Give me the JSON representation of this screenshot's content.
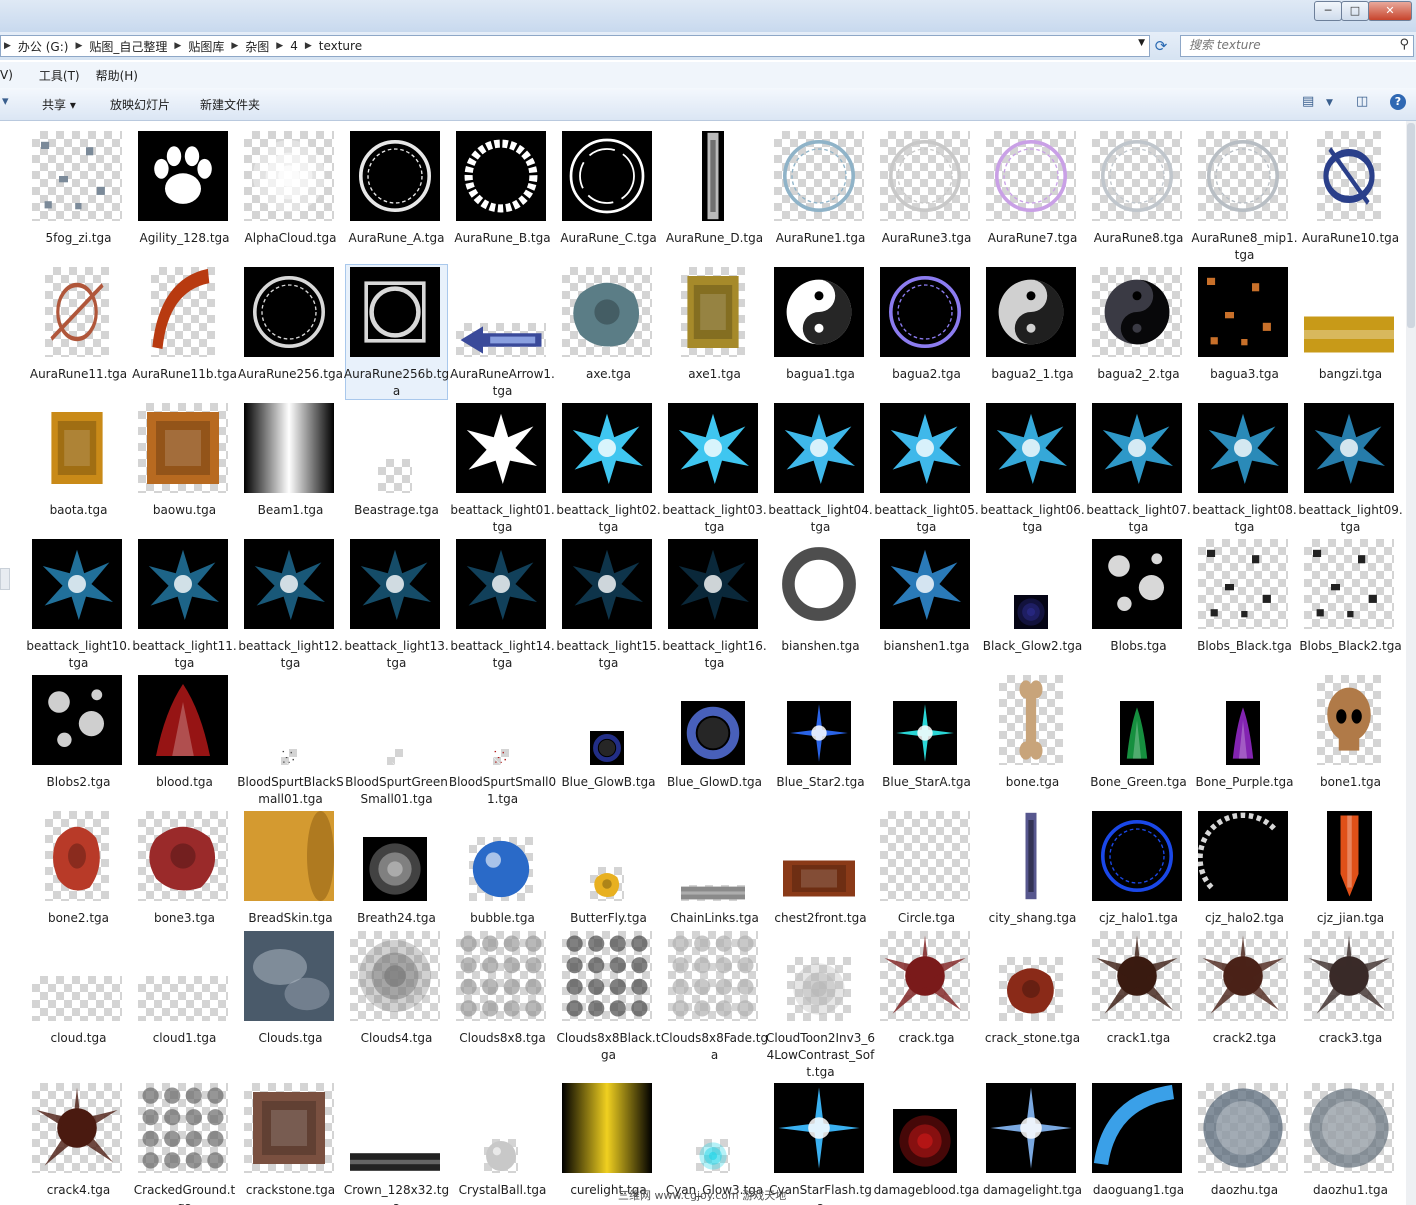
{
  "window": {
    "min_icon": "─",
    "max_icon": "□",
    "close_icon": "✕"
  },
  "address": {
    "crumbs": [
      "办公 (G:)",
      "贴图_自己整理",
      "贴图库",
      "杂图",
      "4",
      "texture"
    ],
    "search_placeholder": "搜索 texture"
  },
  "menu": [
    "V)",
    "工具(T)",
    "帮助(H)"
  ],
  "commands": {
    "share": "共享 ▾",
    "slideshow": "放映幻灯片",
    "new_folder": "新建文件夹"
  },
  "watermark": "三维网 www.cgjoy.com 游戏天地",
  "files": [
    {
      "name": "5fog_zi.tga",
      "bg": "checker",
      "art": "specks",
      "c": "#7b8a99"
    },
    {
      "name": "Agility_128.tga",
      "bg": "black",
      "art": "paw",
      "c": "#ffffff"
    },
    {
      "name": "AlphaCloud.tga",
      "bg": "checker",
      "art": "glow",
      "c": "#ffffff"
    },
    {
      "name": "AuraRune_A.tga",
      "bg": "black",
      "art": "ring",
      "c": "#e8e8e8"
    },
    {
      "name": "AuraRune_B.tga",
      "bg": "black",
      "art": "thickring",
      "c": "#ffffff"
    },
    {
      "name": "AuraRune_C.tga",
      "bg": "black",
      "art": "ring2",
      "c": "#ffffff"
    },
    {
      "name": "AuraRune_D.tga",
      "bg": "black",
      "art": "strip",
      "c": "#dcdcdc",
      "w": 22
    },
    {
      "name": "AuraRune1.tga",
      "bg": "checker",
      "art": "ring",
      "c": "#8fb3c8"
    },
    {
      "name": "AuraRune3.tga",
      "bg": "checker",
      "art": "ring",
      "c": "#c8c8c8"
    },
    {
      "name": "AuraRune7.tga",
      "bg": "checker",
      "art": "ring",
      "c": "#c9a0e6"
    },
    {
      "name": "AuraRune8.tga",
      "bg": "checker",
      "art": "ring",
      "c": "#c0c6cc"
    },
    {
      "name": "AuraRune8_mip1.tga",
      "bg": "checker",
      "art": "ring",
      "c": "#b8bec4"
    },
    {
      "name": "AuraRune10.tga",
      "bg": "checker",
      "art": "emblem",
      "c": "#2a3f8a",
      "w": 64
    },
    {
      "name": "AuraRune11.tga",
      "bg": "checker",
      "art": "rune",
      "c": "#b0563a",
      "w": 64
    },
    {
      "name": "AuraRune11b.tga",
      "bg": "checker",
      "art": "arc",
      "c": "#b83a10",
      "w": 64
    },
    {
      "name": "AuraRune256.tga",
      "bg": "black",
      "art": "ring",
      "c": "#d8d8d8"
    },
    {
      "name": "AuraRune256b.tga",
      "bg": "black",
      "art": "square",
      "c": "#d8d8d8"
    },
    {
      "name": "AuraRuneArrow1.tga",
      "bg": "checker",
      "art": "arrow",
      "c": "#3a4a9a",
      "w": 90,
      "h": 34
    },
    {
      "name": "axe.tga",
      "bg": "checker",
      "art": "blob",
      "c": "#5b7d86"
    },
    {
      "name": "axe1.tga",
      "bg": "checker",
      "art": "block",
      "c": "#a68a2a",
      "w": 64
    },
    {
      "name": "bagua1.tga",
      "bg": "black",
      "art": "yinyang",
      "c": "#ffffff"
    },
    {
      "name": "bagua2.tga",
      "bg": "black",
      "art": "ring",
      "c": "#8c7cf0"
    },
    {
      "name": "bagua2_1.tga",
      "bg": "black",
      "art": "yinyang",
      "c": "#d0d0d0"
    },
    {
      "name": "bagua2_2.tga",
      "bg": "checker",
      "art": "yinyang",
      "c": "#3a3a44"
    },
    {
      "name": "bagua3.tga",
      "bg": "black",
      "art": "specks",
      "c": "#c8702a"
    },
    {
      "name": "bangzi.tga",
      "bg": "none",
      "art": "bar",
      "c": "#c89a18",
      "h": 45
    },
    {
      "name": "baota.tga",
      "bg": "none",
      "art": "block",
      "c": "#c98a18",
      "w": 64
    },
    {
      "name": "baowu.tga",
      "bg": "checker",
      "art": "block",
      "c": "#b86a20"
    },
    {
      "name": "Beam1.tga",
      "bg": "black",
      "art": "beam",
      "c": "#ffffff"
    },
    {
      "name": "Beastrage.tga",
      "bg": "checker",
      "art": "none",
      "c": "#cccccc",
      "w": 34,
      "h": 34
    },
    {
      "name": "beattack_light01.tga",
      "bg": "black",
      "art": "splash",
      "c": "#ffffff"
    },
    {
      "name": "beattack_light02.tga",
      "bg": "black",
      "art": "splash",
      "c": "#3fc6f0"
    },
    {
      "name": "beattack_light03.tga",
      "bg": "black",
      "art": "splash",
      "c": "#3fc6f0"
    },
    {
      "name": "beattack_light04.tga",
      "bg": "black",
      "art": "splash",
      "c": "#3fb8ea"
    },
    {
      "name": "beattack_light05.tga",
      "bg": "black",
      "art": "splash",
      "c": "#3fb8ea"
    },
    {
      "name": "beattack_light06.tga",
      "bg": "black",
      "art": "splash",
      "c": "#35a8d8"
    },
    {
      "name": "beattack_light07.tga",
      "bg": "black",
      "art": "splash",
      "c": "#2e98c8"
    },
    {
      "name": "beattack_light08.tga",
      "bg": "black",
      "art": "splash",
      "c": "#2a8ab8"
    },
    {
      "name": "beattack_light09.tga",
      "bg": "black",
      "art": "splash",
      "c": "#267caa"
    },
    {
      "name": "beattack_light10.tga",
      "bg": "black",
      "art": "splash",
      "c": "#21709a"
    },
    {
      "name": "beattack_light11.tga",
      "bg": "black",
      "art": "splash",
      "c": "#1d6488"
    },
    {
      "name": "beattack_light12.tga",
      "bg": "black",
      "art": "splash",
      "c": "#195878"
    },
    {
      "name": "beattack_light13.tga",
      "bg": "black",
      "art": "splash",
      "c": "#154c68"
    },
    {
      "name": "beattack_light14.tga",
      "bg": "black",
      "art": "splash",
      "c": "#11405a"
    },
    {
      "name": "beattack_light15.tga",
      "bg": "black",
      "art": "splash",
      "c": "#0e344a"
    },
    {
      "name": "beattack_light16.tga",
      "bg": "black",
      "art": "splash",
      "c": "#0a283a"
    },
    {
      "name": "bianshen.tga",
      "bg": "none",
      "art": "softring",
      "c": "#222222"
    },
    {
      "name": "bianshen1.tga",
      "bg": "black",
      "art": "splash",
      "c": "#2a7ab8"
    },
    {
      "name": "Black_Glow2.tga",
      "bg": "none",
      "art": "glow",
      "c": "#2a2a8a",
      "w": 34,
      "h": 34,
      "fill": "#050515"
    },
    {
      "name": "Blobs.tga",
      "bg": "black",
      "art": "blobs",
      "c": "#d8d8d8"
    },
    {
      "name": "Blobs_Black.tga",
      "bg": "checker",
      "art": "specks",
      "c": "#222222"
    },
    {
      "name": "Blobs_Black2.tga",
      "bg": "checker",
      "art": "specks",
      "c": "#222222"
    },
    {
      "name": "Blobs2.tga",
      "bg": "black",
      "art": "blobs",
      "c": "#cfcfcf"
    },
    {
      "name": "blood.tga",
      "bg": "black",
      "art": "flame",
      "c": "#b01818"
    },
    {
      "name": "BloodSpurtBlackSmall01.tga",
      "bg": "checker",
      "art": "specks",
      "c": "#444444",
      "w": 16,
      "h": 16
    },
    {
      "name": "BloodSpurtGreenSmall01.tga",
      "bg": "checker",
      "art": "none",
      "c": "#cccccc",
      "w": 16,
      "h": 16
    },
    {
      "name": "BloodSpurtSmall01.tga",
      "bg": "checker",
      "art": "specks",
      "c": "#b01818",
      "w": 16,
      "h": 16
    },
    {
      "name": "Blue_GlowB.tga",
      "bg": "black",
      "art": "softring",
      "c": "#2a3aa8",
      "w": 34,
      "h": 34
    },
    {
      "name": "Blue_GlowD.tga",
      "bg": "black",
      "art": "softring",
      "c": "#5a78e8",
      "w": 64,
      "h": 64
    },
    {
      "name": "Blue_Star2.tga",
      "bg": "black",
      "art": "star",
      "c": "#2a64e8",
      "w": 64,
      "h": 64
    },
    {
      "name": "Blue_StarA.tga",
      "bg": "black",
      "art": "star",
      "c": "#2ad6d6",
      "w": 64,
      "h": 64
    },
    {
      "name": "bone.tga",
      "bg": "checker",
      "art": "bone",
      "c": "#c8a47a",
      "w": 64
    },
    {
      "name": "Bone_Green.tga",
      "bg": "black",
      "art": "flame",
      "c": "#1aa84a",
      "w": 34,
      "h": 64
    },
    {
      "name": "Bone_Purple.tga",
      "bg": "black",
      "art": "flame",
      "c": "#9a2ad0",
      "w": 34,
      "h": 64
    },
    {
      "name": "bone1.tga",
      "bg": "checker",
      "art": "skull",
      "c": "#b07a48",
      "w": 64
    },
    {
      "name": "bone2.tga",
      "bg": "checker",
      "art": "blob",
      "c": "#b83a28",
      "w": 64
    },
    {
      "name": "bone3.tga",
      "bg": "checker",
      "art": "blob",
      "c": "#9a2a2a"
    },
    {
      "name": "BreadSkin.tga",
      "bg": "none",
      "art": "bread",
      "c": "#d49a30"
    },
    {
      "name": "Breath24.tga",
      "bg": "black",
      "art": "glow",
      "c": "#bdbdbd",
      "w": 64,
      "h": 64
    },
    {
      "name": "bubble.tga",
      "bg": "checker",
      "art": "orb",
      "c": "#2a6ac8",
      "w": 64,
      "h": 64
    },
    {
      "name": "ButterFly.tga",
      "bg": "checker",
      "art": "blob",
      "c": "#e8b020",
      "w": 34,
      "h": 34
    },
    {
      "name": "ChainLinks.tga",
      "bg": "checker",
      "art": "bar",
      "c": "#8a8a8a",
      "w": 64,
      "h": 16
    },
    {
      "name": "chest2front.tga",
      "bg": "none",
      "art": "block",
      "c": "#8a3a18",
      "h": 45
    },
    {
      "name": "Circle.tga",
      "bg": "checker",
      "art": "none",
      "c": "#cccccc"
    },
    {
      "name": "city_shang.tga",
      "bg": "none",
      "art": "strip",
      "c": "#3a3a7a",
      "w": 22
    },
    {
      "name": "cjz_halo1.tga",
      "bg": "black",
      "art": "ring",
      "c": "#1a48e8"
    },
    {
      "name": "cjz_halo2.tga",
      "bg": "black",
      "art": "arc2",
      "c": "#d8d8d8"
    },
    {
      "name": "cjz_jian.tga",
      "bg": "black",
      "art": "blade",
      "c": "#e05018",
      "w": 45
    },
    {
      "name": "cloud.tga",
      "bg": "checker",
      "art": "none",
      "c": "#cccccc",
      "h": 45
    },
    {
      "name": "cloud1.tga",
      "bg": "checker",
      "art": "none",
      "c": "#cccccc",
      "h": 45
    },
    {
      "name": "Clouds.tga",
      "bg": "none",
      "art": "clouds",
      "c": "#4a5a6a"
    },
    {
      "name": "Clouds4.tga",
      "bg": "checker",
      "art": "glow",
      "c": "#7a7a7a"
    },
    {
      "name": "Clouds8x8.tga",
      "bg": "checker",
      "art": "grid",
      "c": "#9a9a9a"
    },
    {
      "name": "Clouds8x8Black.tga",
      "bg": "checker",
      "art": "grid",
      "c": "#4a4a4a"
    },
    {
      "name": "Clouds8x8Fade.tga",
      "bg": "checker",
      "art": "grid",
      "c": "#b0b0b0"
    },
    {
      "name": "CloudToon2Inv3_64LowContrast_Soft.tga",
      "bg": "checker",
      "art": "glow",
      "c": "#b8b8b8",
      "w": 64,
      "h": 64
    },
    {
      "name": "crack.tga",
      "bg": "checker",
      "art": "burst",
      "c": "#7a1a1a"
    },
    {
      "name": "crack_stone.tga",
      "bg": "checker",
      "art": "blob",
      "c": "#8a2a18",
      "w": 64,
      "h": 64
    },
    {
      "name": "crack1.tga",
      "bg": "checker",
      "art": "burst",
      "c": "#3a1a10"
    },
    {
      "name": "crack2.tga",
      "bg": "checker",
      "art": "burst",
      "c": "#4a2218"
    },
    {
      "name": "crack3.tga",
      "bg": "checker",
      "art": "burst",
      "c": "#3a2a28"
    },
    {
      "name": "crack4.tga",
      "bg": "checker",
      "art": "burst",
      "c": "#4a1a10"
    },
    {
      "name": "CrackedGround.tga",
      "bg": "checker",
      "art": "grid",
      "c": "#6a6a6a"
    },
    {
      "name": "crackstone.tga",
      "bg": "checker",
      "art": "block",
      "c": "#7a5040"
    },
    {
      "name": "Crown_128x32.tga",
      "bg": "none",
      "art": "bar",
      "c": "#222222",
      "h": 22
    },
    {
      "name": "CrystalBall.tga",
      "bg": "checker",
      "art": "orb",
      "c": "#c8c8c8",
      "w": 34,
      "h": 34
    },
    {
      "name": "curelight.tga",
      "bg": "black",
      "art": "vband",
      "c": "#f0d020"
    },
    {
      "name": "Cyan_Glow3.tga",
      "bg": "checker",
      "art": "glow",
      "c": "#2ad6e8",
      "w": 34,
      "h": 34
    },
    {
      "name": "CyanStarFlash.tga",
      "bg": "black",
      "art": "star",
      "c": "#3ab0f0"
    },
    {
      "name": "damageblood.tga",
      "bg": "black",
      "art": "glow",
      "c": "#c81818",
      "w": 64,
      "h": 64
    },
    {
      "name": "damagelight.tga",
      "bg": "black",
      "art": "star",
      "c": "#7aa8e0"
    },
    {
      "name": "daoguang1.tga",
      "bg": "black",
      "art": "arc",
      "c": "#3aa0e8"
    },
    {
      "name": "daozhu.tga",
      "bg": "checker",
      "art": "softdisc",
      "c": "#5a6a7a"
    },
    {
      "name": "daozhu1.tga",
      "bg": "checker",
      "art": "softdisc",
      "c": "#6a7680"
    }
  ]
}
